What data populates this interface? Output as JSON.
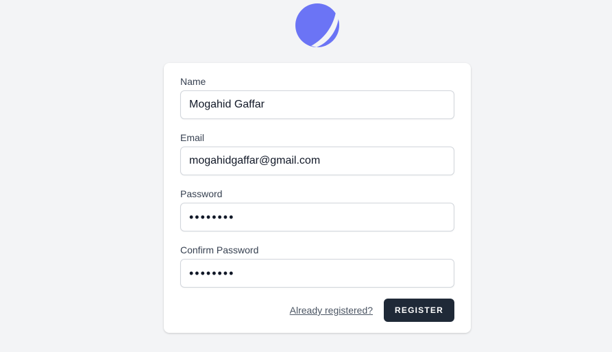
{
  "brand": {
    "logo_icon": "app-logo-icon",
    "logo_color": "#6b74f5"
  },
  "form": {
    "name": {
      "label": "Name",
      "value": "Mogahid Gaffar"
    },
    "email": {
      "label": "Email",
      "value": "mogahidgaffar@gmail.com"
    },
    "password": {
      "label": "Password",
      "value": "password"
    },
    "confirm_password": {
      "label": "Confirm Password",
      "value": "password"
    },
    "login_link": "Already registered?",
    "register_button": "REGISTER",
    "button_color": "#1f2937"
  }
}
